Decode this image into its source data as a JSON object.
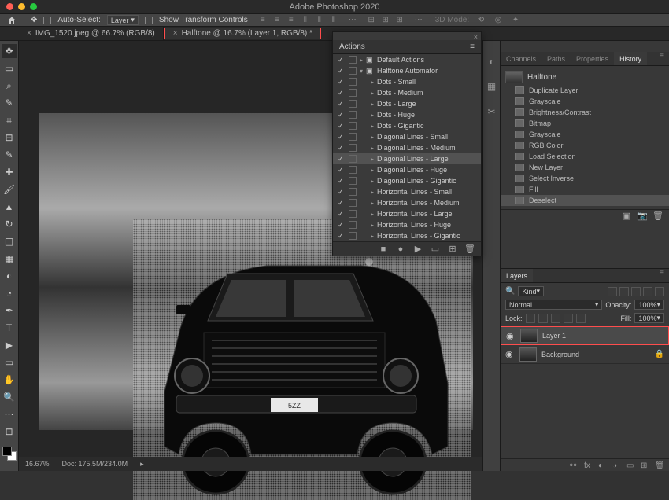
{
  "app": {
    "title": "Adobe Photoshop 2020"
  },
  "option_bar": {
    "auto_select_label": "Auto-Select:",
    "auto_select_value": "Layer",
    "show_transform_label": "Show Transform Controls",
    "mode_label": "3D Mode:"
  },
  "tabs": [
    {
      "label": "IMG_1520.jpeg @ 66.7% (RGB/8)",
      "active": false
    },
    {
      "label": "Halftone @ 16.7% (Layer 1, RGB/8) *",
      "active": true,
      "highlight": true
    }
  ],
  "actions_panel": {
    "title": "Actions",
    "groups": [
      {
        "label": "Default Actions",
        "expanded": false
      },
      {
        "label": "Halftone Automator",
        "expanded": true
      }
    ],
    "items": [
      "Dots - Small",
      "Dots - Medium",
      "Dots - Large",
      "Dots - Huge",
      "Dots - Gigantic",
      "Diagonal Lines - Small",
      "Diagonal Lines - Medium",
      "Diagonal Lines - Large",
      "Diagonal Lines - Huge",
      "Diagonal Lines - Gigantic",
      "Horizontal Lines - Small",
      "Horizontal Lines - Medium",
      "Horizontal Lines - Large",
      "Horizontal Lines - Huge",
      "Horizontal Lines - Gigantic"
    ],
    "selected_index": 7
  },
  "right_panel": {
    "tabs_top": [
      "Channels",
      "Paths",
      "Properties",
      "History"
    ],
    "history_doc": "Halftone",
    "history": [
      "Duplicate Layer",
      "Grayscale",
      "Brightness/Contrast",
      "Bitmap",
      "Grayscale",
      "RGB Color",
      "Load Selection",
      "New Layer",
      "Select Inverse",
      "Fill",
      "Deselect"
    ],
    "history_selected": 10
  },
  "layers_panel": {
    "title": "Layers",
    "kind_label": "Kind",
    "blend_mode": "Normal",
    "opacity_label": "Opacity:",
    "opacity_value": "100%",
    "lock_label": "Lock:",
    "fill_label": "Fill:",
    "fill_value": "100%",
    "layers": [
      {
        "name": "Layer 1",
        "visible": true,
        "highlight": true
      },
      {
        "name": "Background",
        "visible": true,
        "locked": true
      }
    ]
  },
  "status": {
    "zoom": "16.67%",
    "doc_size": "Doc: 175.5M/234.0M"
  }
}
